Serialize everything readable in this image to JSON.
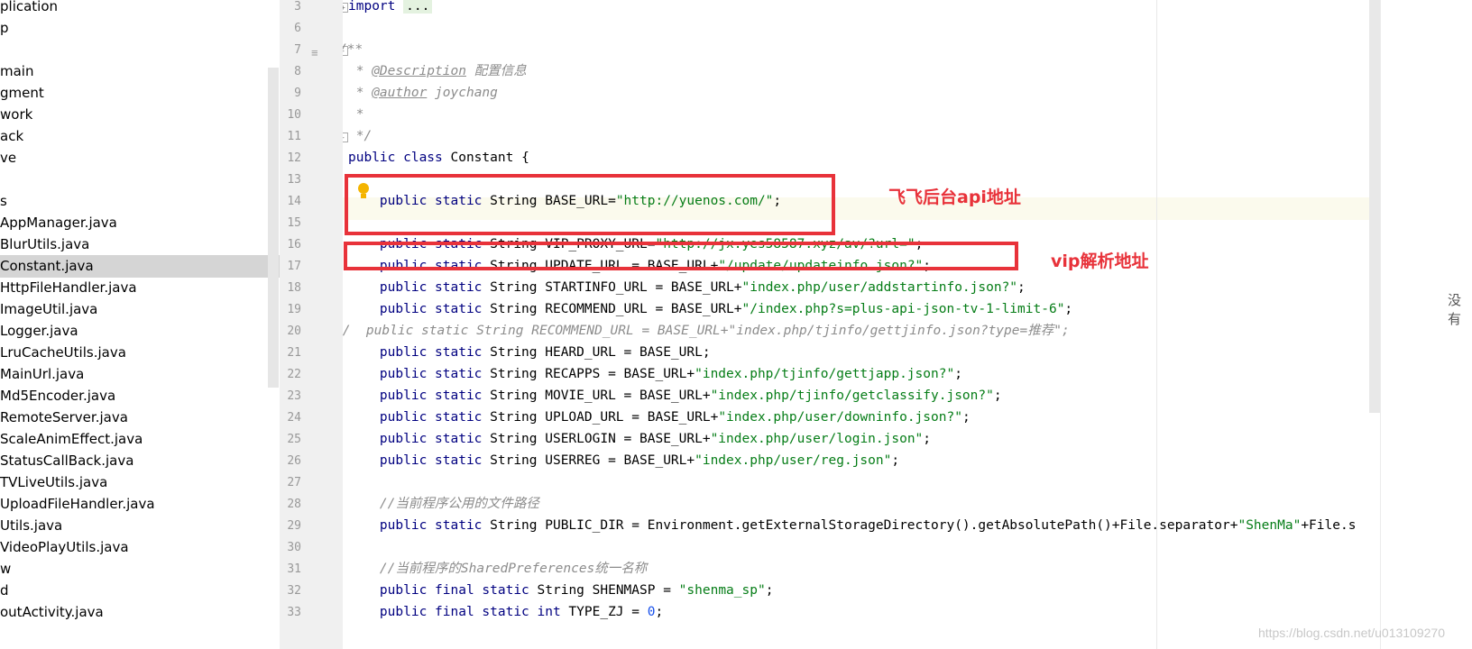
{
  "tree": {
    "items": [
      {
        "label": "plication"
      },
      {
        "label": "p"
      },
      {
        "label": ""
      },
      {
        "label": "main"
      },
      {
        "label": "gment"
      },
      {
        "label": "work"
      },
      {
        "label": "ack"
      },
      {
        "label": "ve"
      },
      {
        "label": ""
      },
      {
        "label": "s"
      },
      {
        "label": "AppManager.java"
      },
      {
        "label": "BlurUtils.java"
      },
      {
        "label": "Constant.java",
        "selected": true
      },
      {
        "label": "HttpFileHandler.java"
      },
      {
        "label": "ImageUtil.java"
      },
      {
        "label": "Logger.java"
      },
      {
        "label": "LruCacheUtils.java"
      },
      {
        "label": "MainUrl.java"
      },
      {
        "label": "Md5Encoder.java"
      },
      {
        "label": "RemoteServer.java"
      },
      {
        "label": "ScaleAnimEffect.java"
      },
      {
        "label": "StatusCallBack.java"
      },
      {
        "label": "TVLiveUtils.java"
      },
      {
        "label": "UploadFileHandler.java"
      },
      {
        "label": "Utils.java"
      },
      {
        "label": "VideoPlayUtils.java"
      },
      {
        "label": "w"
      },
      {
        "label": "d"
      },
      {
        "label": "outActivity.java"
      }
    ]
  },
  "gutter": {
    "lines": [
      "3",
      "6",
      "7",
      "8",
      "9",
      "10",
      "11",
      "12",
      "13",
      "14",
      "15",
      "16",
      "17",
      "18",
      "19",
      "20",
      "21",
      "22",
      "23",
      "24",
      "25",
      "26",
      "27",
      "28",
      "29",
      "30",
      "31",
      "32",
      "33"
    ]
  },
  "code": {
    "l3_import": "import",
    "l3_dots": "...",
    "l7": "/**",
    "l8_star": " * ",
    "l8_tag": "@Description",
    "l8_text": " 配置信息",
    "l9_star": " * ",
    "l9_tag": "@author",
    "l9_text": " joychang",
    "l10": " *",
    "l11": " */",
    "l12_kw": "public class",
    "l12_rest": " Constant {",
    "l14_kw": "    public static",
    "l14_mid": " String BASE_URL=",
    "l14_str": "\"http://yuenos.com/\"",
    "l14_end": ";",
    "l16_kw": "    public static",
    "l16_mid": " String VIP_PROXY_URL=",
    "l16_str": "\"http://jx.yes58587.xyz/av/?url=\"",
    "l16_end": ";",
    "l17_kw": "    public static",
    "l17_mid": " String UPDATE_URL = BASE_URL+",
    "l17_str": "\"/update/updateinfo.json?\"",
    "l17_end": ";",
    "l18_kw": "    public static",
    "l18_mid": " String STARTINFO_URL = BASE_URL+",
    "l18_str": "\"index.php/user/addstartinfo.json?\"",
    "l18_end": ";",
    "l19_kw": "    public static",
    "l19_mid": " String RECOMMEND_URL = BASE_URL+",
    "l19_str": "\"/index.php?s=plus-api-json-tv-1-limit-6\"",
    "l19_end": ";",
    "l20": "//  public static String RECOMMEND_URL = BASE_URL+\"index.php/tjinfo/gettjinfo.json?type=推荐\";",
    "l21_kw": "    public static",
    "l21_mid": " String HEARD_URL = BASE_URL;",
    "l22_kw": "    public static",
    "l22_mid": " String RECAPPS = BASE_URL+",
    "l22_str": "\"index.php/tjinfo/gettjapp.json?\"",
    "l22_end": ";",
    "l23_kw": "    public static",
    "l23_mid": " String MOVIE_URL = BASE_URL+",
    "l23_str": "\"index.php/tjinfo/getclassify.json?\"",
    "l23_end": ";",
    "l24_kw": "    public static",
    "l24_mid": " String UPLOAD_URL = BASE_URL+",
    "l24_str": "\"index.php/user/downinfo.json?\"",
    "l24_end": ";",
    "l25_kw": "    public static",
    "l25_mid": " String USERLOGIN = BASE_URL+",
    "l25_str": "\"index.php/user/login.json\"",
    "l25_end": ";",
    "l26_kw": "    public static",
    "l26_mid": " String USERREG = BASE_URL+",
    "l26_str": "\"index.php/user/reg.json\"",
    "l26_end": ";",
    "l28": "    //当前程序公用的文件路径",
    "l29_kw": "    public static",
    "l29_mid": " String PUBLIC_DIR = Environment.getExternalStorageDirectory().getAbsolutePath()+File.separator+",
    "l29_str": "\"ShenMa\"",
    "l29_end": "+File.s",
    "l31": "    //当前程序的SharedPreferences统一名称",
    "l32_kw": "    public final static",
    "l32_mid": " String SHENMASP = ",
    "l32_str": "\"shenma_sp\"",
    "l32_end": ";",
    "l33_kw": "    public final static int",
    "l33_mid": " TYPE_ZJ = ",
    "l33_num": "0",
    "l33_end": ";"
  },
  "right_truncated_text": "没有",
  "annotations": {
    "api_label": "飞飞后台api地址",
    "vip_label": "vip解析地址"
  },
  "watermark": "https://blog.csdn.net/u013109270",
  "colors": {
    "keyword": "#000080",
    "string": "#067d17",
    "comment": "#8c8c8c",
    "annotation": "#e8323a",
    "selected_row": "#d5d5d5"
  }
}
